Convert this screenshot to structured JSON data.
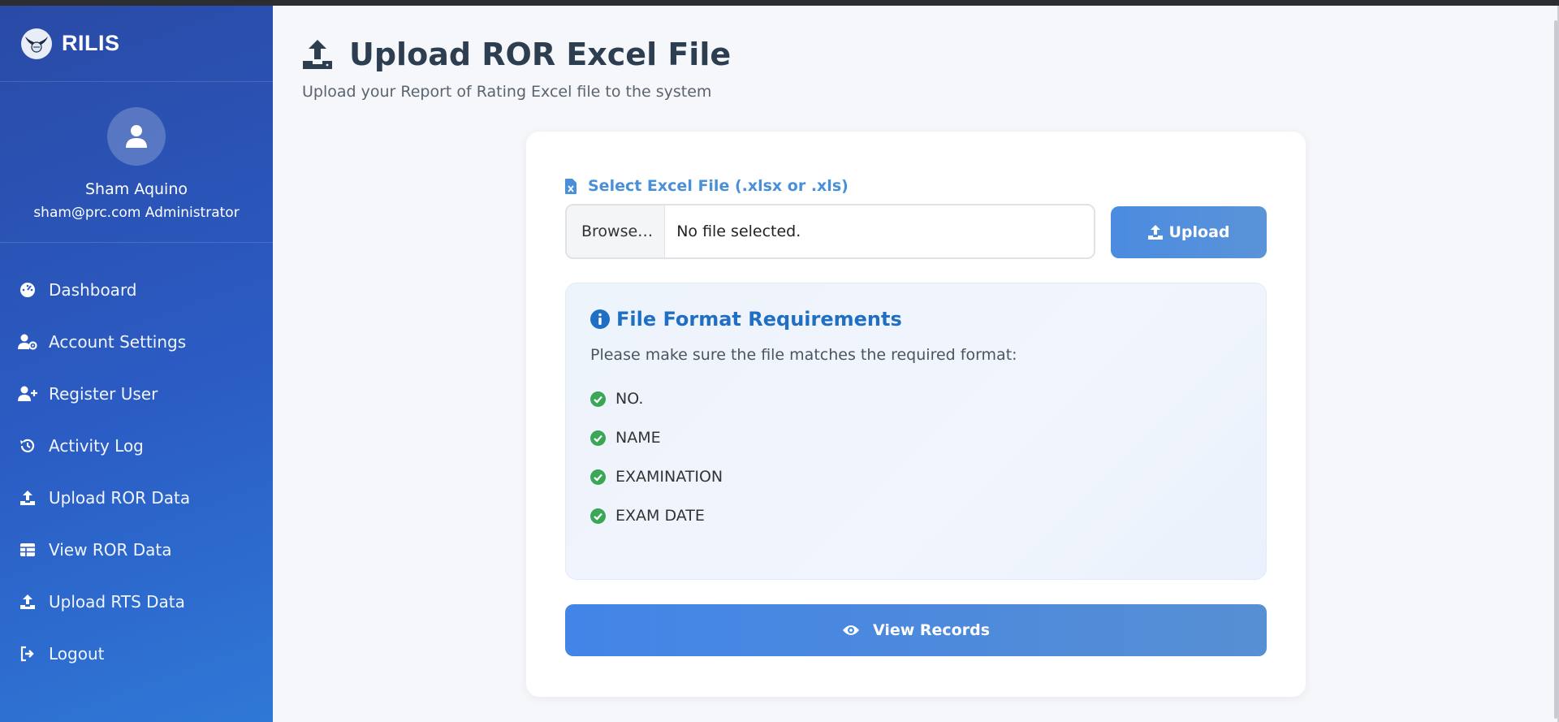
{
  "app": {
    "name": "RILIS"
  },
  "user": {
    "name": "Sham Aquino",
    "email_role": "sham@prc.com Administrator"
  },
  "sidebar": {
    "items": [
      {
        "label": "Dashboard",
        "icon": "dashboard-icon"
      },
      {
        "label": "Account Settings",
        "icon": "user-gear-icon"
      },
      {
        "label": "Register User",
        "icon": "user-plus-icon"
      },
      {
        "label": "Activity Log",
        "icon": "history-icon"
      },
      {
        "label": "Upload ROR Data",
        "icon": "upload-icon"
      },
      {
        "label": "View ROR Data",
        "icon": "table-icon"
      },
      {
        "label": "Upload RTS Data",
        "icon": "upload-icon"
      },
      {
        "label": "Logout",
        "icon": "logout-icon"
      }
    ]
  },
  "page": {
    "title": "Upload ROR Excel File",
    "subtitle": "Upload your Report of Rating Excel file to the system"
  },
  "form": {
    "file_label": "Select Excel File (.xlsx or .xls)",
    "browse_label": "Browse…",
    "file_status": "No file selected.",
    "upload_label": "Upload"
  },
  "requirements": {
    "title": "File Format Requirements",
    "description": "Please make sure the file matches the required format:",
    "items": [
      "NO.",
      "NAME",
      "EXAMINATION",
      "EXAM DATE"
    ]
  },
  "view_records_label": "View Records",
  "colors": {
    "sidebar_start": "#2a4aa6",
    "sidebar_end": "#2f78d6",
    "accent": "#4a90d9",
    "check": "#3aa657",
    "title_blue": "#1f6fc4"
  }
}
